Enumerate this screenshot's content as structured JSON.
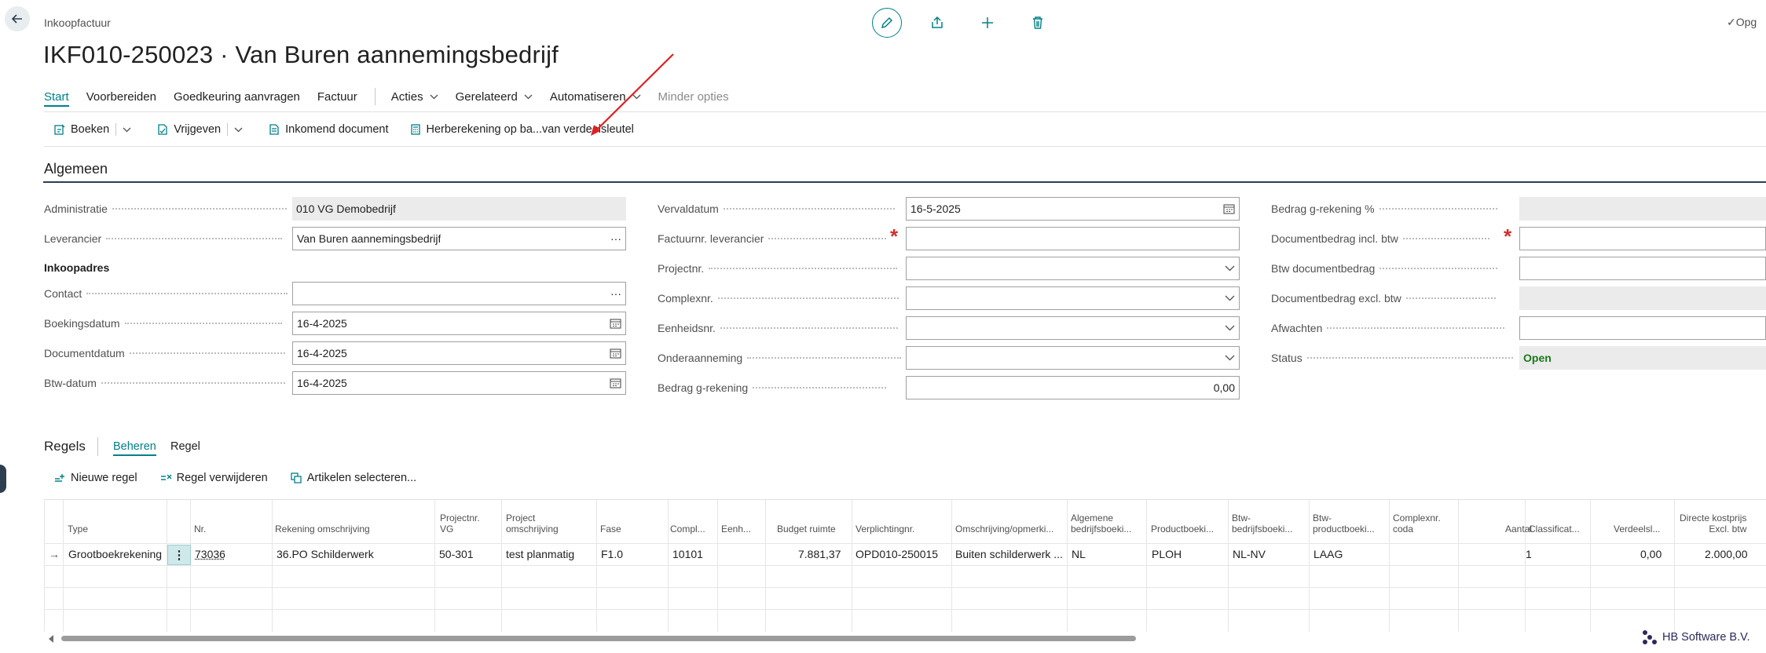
{
  "header": {
    "breadcrumb": "Inkoopfactuur",
    "title": "IKF010-250023 · Van Buren aannemingsbedrijf",
    "saved_label": "Opg"
  },
  "menu": {
    "items": [
      {
        "label": "Start",
        "active": true
      },
      {
        "label": "Voorbereiden"
      },
      {
        "label": "Goedkeuring aanvragen"
      },
      {
        "label": "Factuur"
      },
      {
        "label": "Acties"
      },
      {
        "label": "Gerelateerd"
      },
      {
        "label": "Automatiseren"
      },
      {
        "label": "Minder opties"
      }
    ]
  },
  "actions": {
    "boeken": "Boeken",
    "vrijgeven": "Vrijgeven",
    "inkomend": "Inkomend document",
    "herberekening": "Herberekening op ba...van verdeelsleutel"
  },
  "general": {
    "section_title": "Algemeen",
    "col1": {
      "administratie_label": "Administratie",
      "administratie_value": "010 VG Demobedrijf",
      "leverancier_label": "Leverancier",
      "leverancier_value": "Van Buren aannemingsbedrijf",
      "inkoopadres_label": "Inkoopadres",
      "contact_label": "Contact",
      "contact_value": "",
      "boekingsdatum_label": "Boekingsdatum",
      "boekingsdatum_value": "16-4-2025",
      "documentdatum_label": "Documentdatum",
      "documentdatum_value": "16-4-2025",
      "btwdatum_label": "Btw-datum",
      "btwdatum_value": "16-4-2025"
    },
    "col2": {
      "vervaldatum_label": "Vervaldatum",
      "vervaldatum_value": "16-5-2025",
      "factuurnr_label": "Factuurnr. leverancier",
      "factuurnr_value": "",
      "projectnr_label": "Projectnr.",
      "complexnr_label": "Complexnr.",
      "eenheidsnr_label": "Eenheidsnr.",
      "onderaanneming_label": "Onderaanneming",
      "bedrag_label": "Bedrag g-rekening",
      "bedrag_value": "0,00"
    },
    "col3": {
      "bedrag_pct_label": "Bedrag g-rekening %",
      "docbedrag_incl_label": "Documentbedrag incl. btw",
      "btw_docbedrag_label": "Btw documentbedrag",
      "docbedrag_excl_label": "Documentbedrag excl. btw",
      "afwachten_label": "Afwachten",
      "status_label": "Status",
      "status_value": "Open"
    }
  },
  "regels": {
    "title": "Regels",
    "tabs": [
      "Beheren",
      "Regel"
    ],
    "actions": {
      "nieuwe": "Nieuwe regel",
      "verwijderen": "Regel verwijderen",
      "artikelen": "Artikelen selecteren..."
    },
    "columns": [
      [
        "Type"
      ],
      [
        "Nr."
      ],
      [
        "Rekening omschrijving"
      ],
      [
        "Projectnr.",
        "VG"
      ],
      [
        "Project",
        "omschrijving"
      ],
      [
        "Fase"
      ],
      [
        "Compl..."
      ],
      [
        "Eenh..."
      ],
      [
        "Budget ruimte"
      ],
      [
        "Verplichtingnr."
      ],
      [
        "Omschrijving/opmerki..."
      ],
      [
        "Algemene",
        "bedrijfsboeki..."
      ],
      [
        "Productboeki..."
      ],
      [
        "Btw-",
        "bedrijfsboeki..."
      ],
      [
        "Btw-",
        "productboeki..."
      ],
      [
        "Complexnr.",
        "coda"
      ],
      [
        "Aantal"
      ],
      [
        "Classificat..."
      ],
      [
        "Verdeelsl..."
      ],
      [
        "Directe kostprijs",
        "Excl. btw"
      ]
    ],
    "row": {
      "type": "Grootboekrekening",
      "nr": "73036",
      "rekening": "36.PO Schilderwerk",
      "projectnr": "50-301",
      "project_omschrijving": "test planmatig",
      "fase": "F1.0",
      "compl": "10101",
      "eenh": "",
      "budget": "7.881,37",
      "verplichtingnr": "OPD010-250015",
      "omschrijving": "Buiten schilderwerk ...",
      "algemene": "NL",
      "productboeking": "PLOH",
      "btw_bedrijf": "NL-NV",
      "btw_product": "LAAG",
      "complexnr_coda": "",
      "aantal": "1",
      "classificatie": "",
      "verdeelsleutel": "0,00",
      "kostprijs": "2.000,00"
    }
  },
  "brand": "HB Software B.V.",
  "colors": {
    "accent": "#00808a",
    "required": "#d32f2f",
    "status_open": "#1b7a1b",
    "annotation_arrow": "#e02020"
  }
}
